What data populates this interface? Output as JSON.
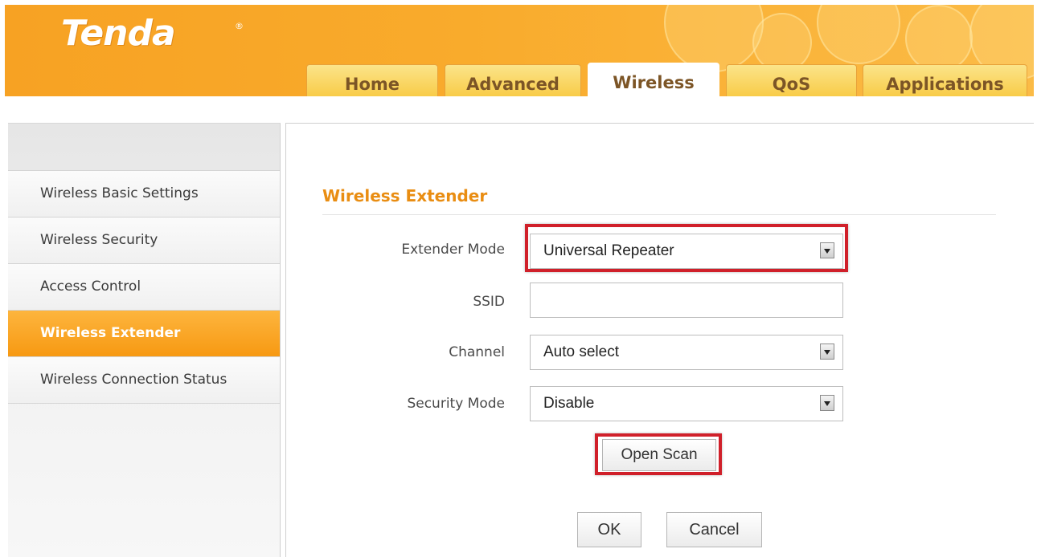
{
  "brand": {
    "logo_text": "Tenda",
    "reg_mark": "®"
  },
  "nav": {
    "tabs": [
      {
        "label": "Home"
      },
      {
        "label": "Advanced"
      },
      {
        "label": "Wireless",
        "active": true
      },
      {
        "label": "QoS"
      },
      {
        "label": "Applications"
      }
    ]
  },
  "sidebar": {
    "items": [
      {
        "label": "Wireless Basic Settings"
      },
      {
        "label": "Wireless Security"
      },
      {
        "label": "Access Control"
      },
      {
        "label": "Wireless Extender",
        "active": true
      },
      {
        "label": "Wireless Connection Status"
      }
    ]
  },
  "main": {
    "section_title": "Wireless Extender",
    "extender_mode": {
      "label": "Extender Mode",
      "value": "Universal Repeater"
    },
    "ssid": {
      "label": "SSID",
      "value": ""
    },
    "channel": {
      "label": "Channel",
      "value": "Auto select"
    },
    "security_mode": {
      "label": "Security Mode",
      "value": "Disable"
    },
    "open_scan_label": "Open Scan",
    "ok_label": "OK",
    "cancel_label": "Cancel"
  },
  "colors": {
    "brand_orange": "#f7a223",
    "title_orange": "#e98d12",
    "highlight_red": "#d0202a"
  }
}
